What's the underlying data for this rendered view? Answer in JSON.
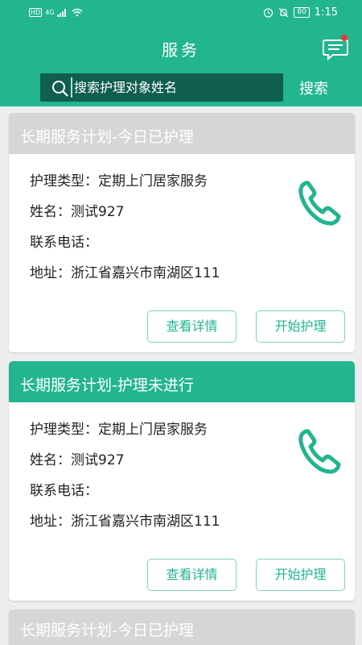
{
  "status_bar": {
    "left_indicators": [
      "HD",
      "4G"
    ],
    "battery": "80",
    "time": "1:15"
  },
  "header": {
    "title": "服务",
    "message_icon": "message-icon"
  },
  "search": {
    "placeholder": "搜索护理对象姓名",
    "button_label": "搜索"
  },
  "colors": {
    "accent": "#22b58f",
    "search_bg": "#0f5e4e",
    "header_gray": "#d6d6d6"
  },
  "labels": {
    "care_type": "护理类型：",
    "name": "姓名：",
    "phone": "联系电话：",
    "address": "地址：",
    "view_details": "查看详情",
    "start_care": "开始护理"
  },
  "cards": [
    {
      "title": "长期服务计划-今日已护理",
      "care_type": "定期上门居家服务",
      "name": "测试927",
      "phone": "",
      "address": "浙江省嘉兴市南湖区111"
    },
    {
      "title": "长期服务计划-护理未进行",
      "care_type": "定期上门居家服务",
      "name": "测试927",
      "phone": "",
      "address": "浙江省嘉兴市南湖区111"
    },
    {
      "title": "长期服务计划-今日已护理"
    }
  ]
}
